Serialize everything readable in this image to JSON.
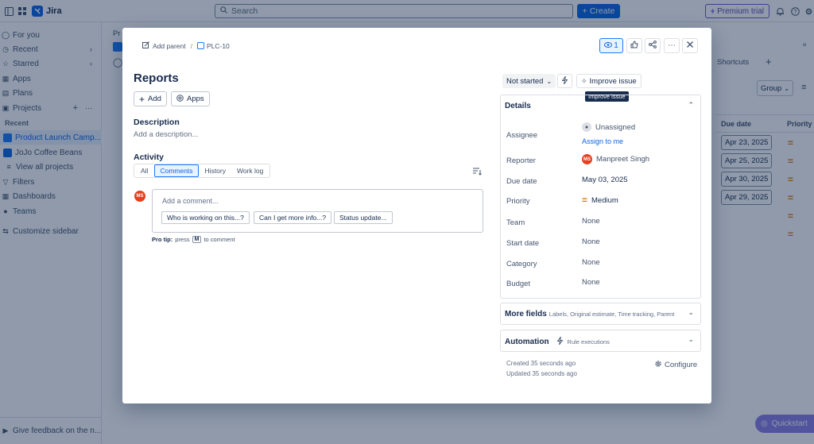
{
  "topbar": {
    "app_name": "Jira",
    "search_placeholder": "Search",
    "create_label": "Create",
    "premium_label": "Premium trial"
  },
  "sidebar": {
    "items": [
      {
        "label": "For you"
      },
      {
        "label": "Recent"
      },
      {
        "label": "Starred"
      },
      {
        "label": "Apps"
      },
      {
        "label": "Plans"
      },
      {
        "label": "Projects"
      }
    ],
    "recent_label": "Recent",
    "projects": [
      {
        "label": "Product Launch Camp..."
      },
      {
        "label": "JoJo Coffee Beans"
      }
    ],
    "view_all": "View all projects",
    "more_items": [
      {
        "label": "Filters"
      },
      {
        "label": "Dashboards"
      },
      {
        "label": "Teams"
      }
    ],
    "customize": "Customize sidebar",
    "feedback": "Give feedback on the n..."
  },
  "background": {
    "crumb_fragment": "Pr",
    "shortcuts_label": "Shortcuts",
    "group_label": "Group",
    "col_due_date": "Due date",
    "col_priority": "Priority",
    "due_dates": [
      "Apr 23, 2025",
      "Apr 25, 2025",
      "Apr 30, 2025",
      "Apr 29, 2025"
    ]
  },
  "modal": {
    "breadcrumb": {
      "add_parent": "Add parent",
      "separator": "/",
      "issue_key": "PLC-10"
    },
    "watch_count": "1",
    "title": "Reports",
    "add_label": "Add",
    "apps_label": "Apps",
    "description": {
      "heading": "Description",
      "placeholder": "Add a description..."
    },
    "activity": {
      "heading": "Activity",
      "tabs": [
        "All",
        "Comments",
        "History",
        "Work log"
      ],
      "selected_tab": "Comments",
      "avatar_initials": "MS",
      "comment_placeholder": "Add a comment...",
      "suggestions": [
        "Who is working on this...?",
        "Can I get more info...?",
        "Status update..."
      ],
      "protip_bold": "Pro tip:",
      "protip_press": "press",
      "protip_key": "M",
      "protip_rest": "to comment"
    },
    "status": "Not started",
    "improve_label": "Improve issue",
    "tooltip": "Improve issue",
    "details": {
      "heading": "Details",
      "assignee_label": "Assignee",
      "assignee_value": "Unassigned",
      "assign_to_me": "Assign to me",
      "reporter_label": "Reporter",
      "reporter_initials": "MS",
      "reporter_value": "Manpreet Singh",
      "due_date_label": "Due date",
      "due_date_value": "May 03, 2025",
      "priority_label": "Priority",
      "priority_value": "Medium",
      "team_label": "Team",
      "team_value": "None",
      "start_date_label": "Start date",
      "start_date_value": "None",
      "category_label": "Category",
      "category_value": "None",
      "budget_label": "Budget",
      "budget_value": "None"
    },
    "more_fields": {
      "heading": "More fields",
      "sub": "Labels, Original estimate, Time tracking, Parent"
    },
    "automation": {
      "heading": "Automation",
      "sub": "Rule executions"
    },
    "created": "Created 35 seconds ago",
    "updated": "Updated 35 seconds ago",
    "configure": "Configure"
  },
  "quickstart": "Quickstart",
  "colors": {
    "accent": "#0c66e4",
    "avatar": "#e5401f",
    "priority_medium": "#e2770c",
    "premium": "#5e4db2",
    "quickstart": "#8f7ee7"
  }
}
